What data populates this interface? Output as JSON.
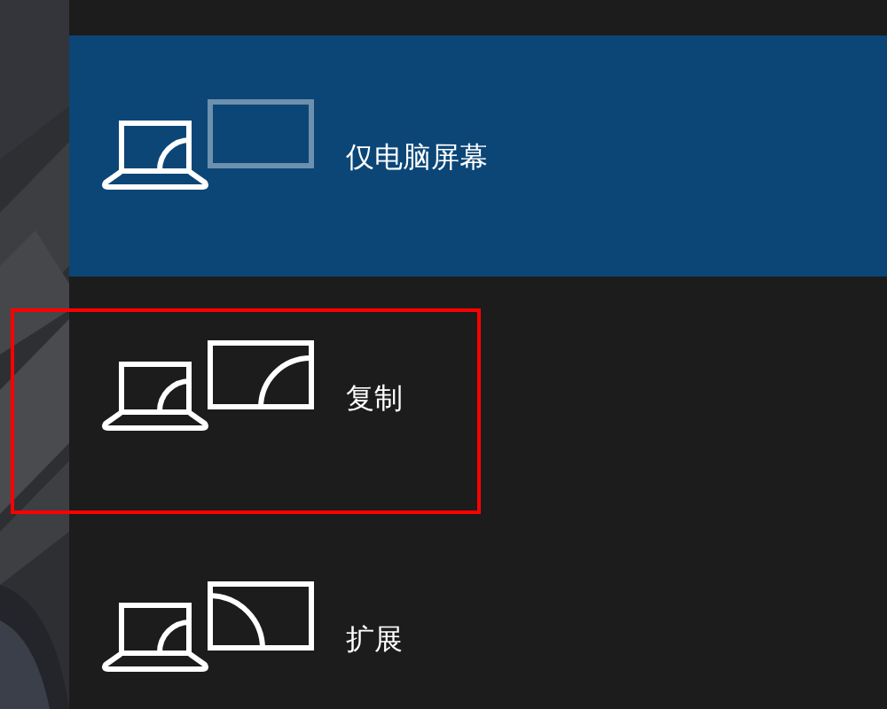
{
  "items": [
    {
      "label": "仅电脑屏幕",
      "kind": "pc_only",
      "selected": true,
      "highlighted": false
    },
    {
      "label": "复制",
      "kind": "duplicate",
      "selected": false,
      "highlighted": true
    },
    {
      "label": "扩展",
      "kind": "extend",
      "selected": false,
      "highlighted": false
    }
  ]
}
